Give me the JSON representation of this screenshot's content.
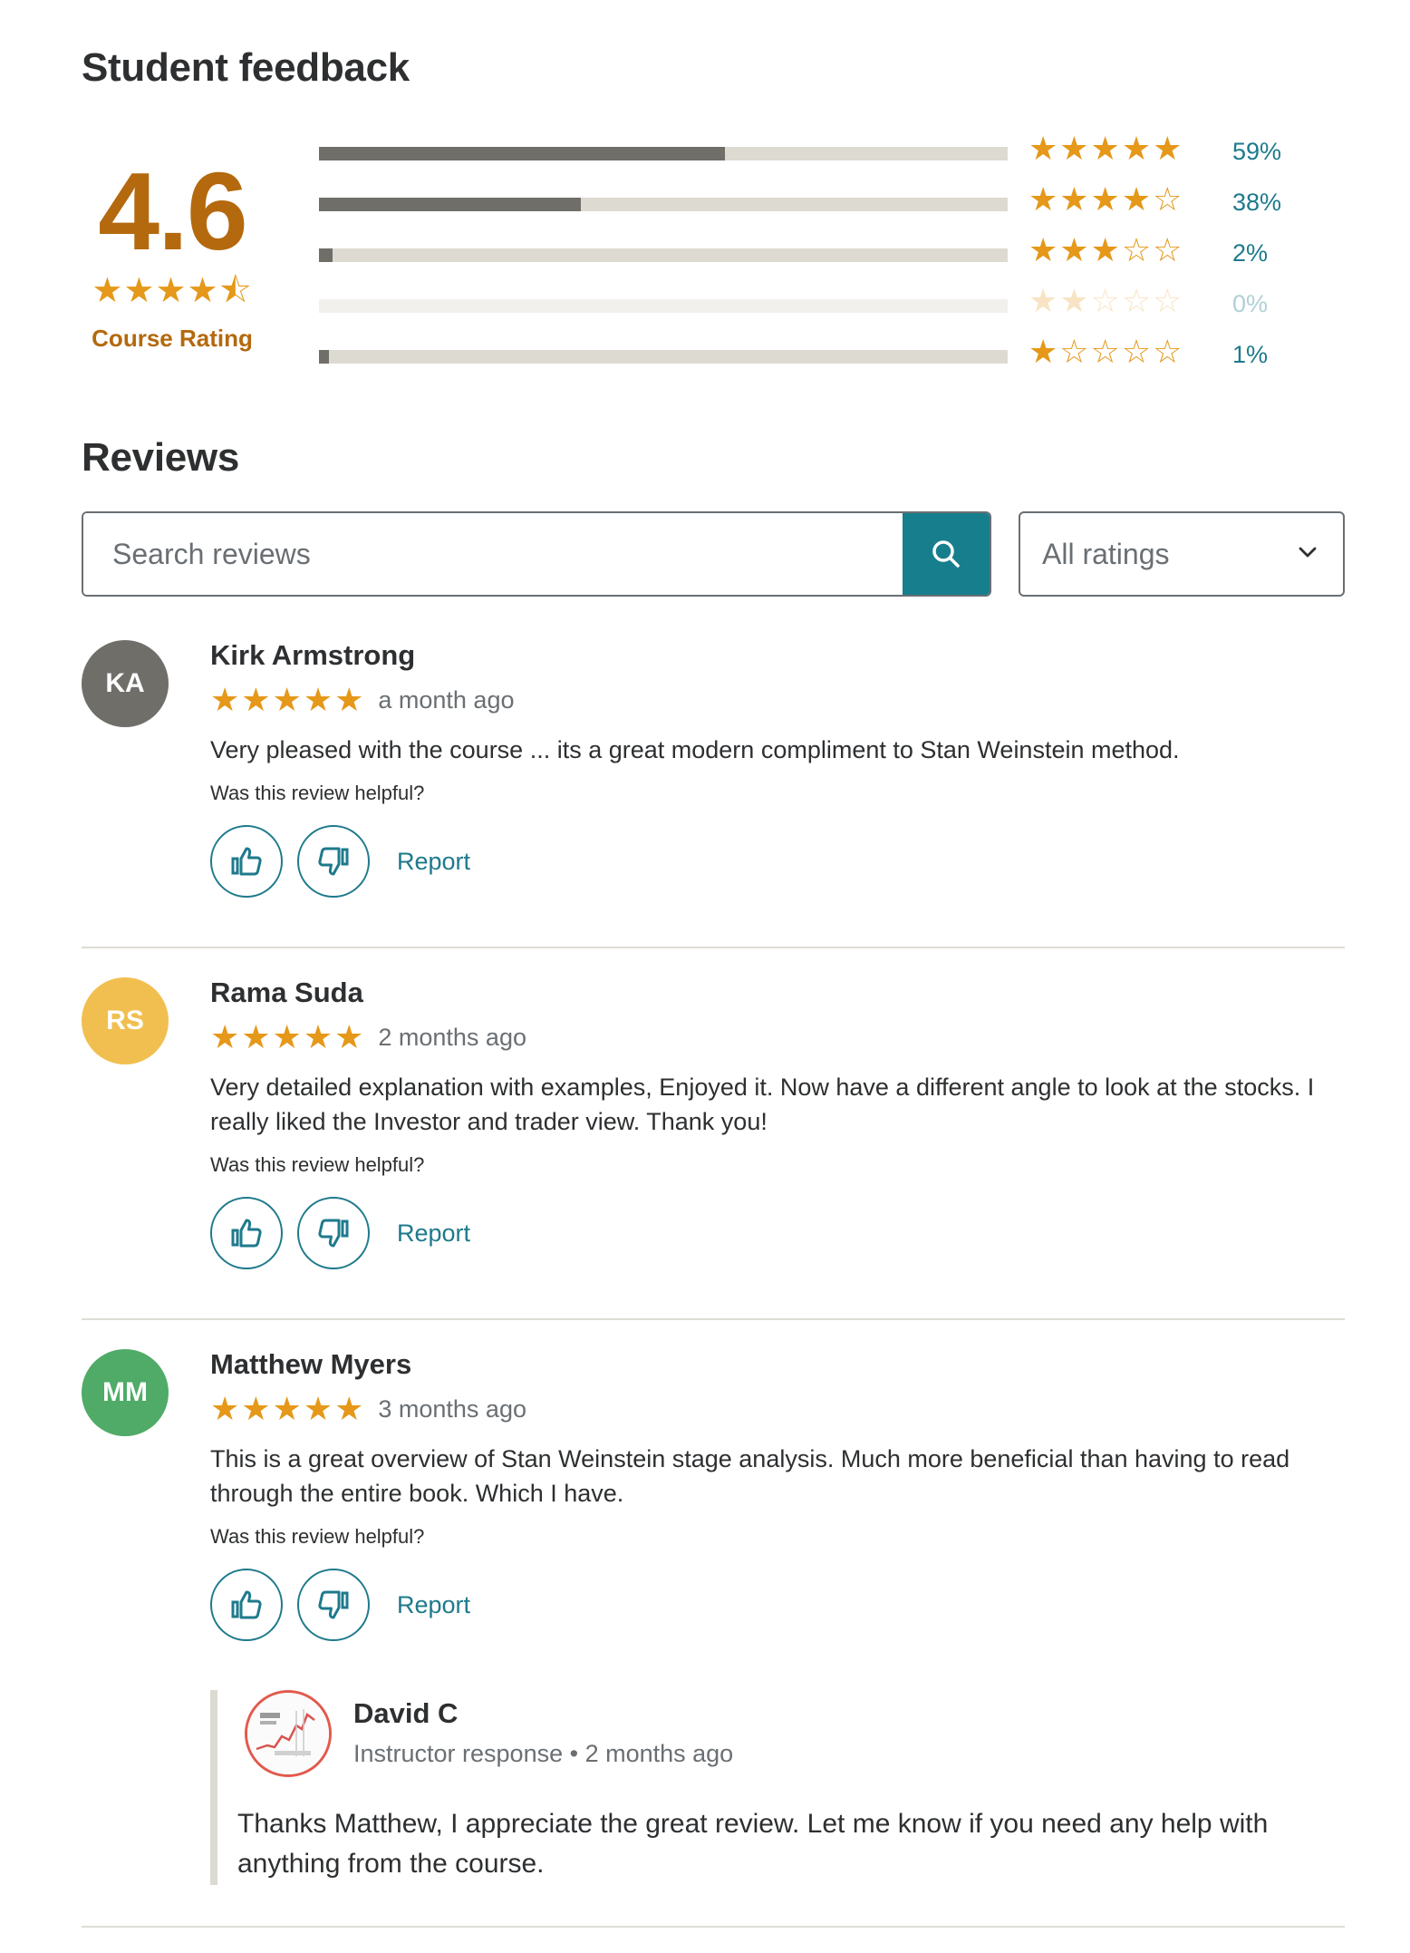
{
  "feedback": {
    "title": "Student feedback",
    "rating": "4.6",
    "rating_stars": "★★★★⯪",
    "rating_label": "Course Rating",
    "distribution": [
      {
        "stars": 5,
        "star_glyphs": "★★★★★",
        "percent_label": "59%",
        "fraction": 0.59
      },
      {
        "stars": 4,
        "star_glyphs": "★★★★☆",
        "percent_label": "38%",
        "fraction": 0.38
      },
      {
        "stars": 3,
        "star_glyphs": "★★★☆☆",
        "percent_label": "2%",
        "fraction": 0.02
      },
      {
        "stars": 2,
        "star_glyphs": "★★☆☆☆",
        "percent_label": "0%",
        "fraction": 0.0
      },
      {
        "stars": 1,
        "star_glyphs": "★☆☆☆☆",
        "percent_label": "1%",
        "fraction": 0.01
      }
    ]
  },
  "reviews_section": {
    "title": "Reviews",
    "search_placeholder": "Search reviews",
    "filter_value": "All ratings"
  },
  "reviews": [
    {
      "initials": "KA",
      "avatar_color": "#6f6e69",
      "name": "Kirk Armstrong",
      "stars": "★★★★★",
      "date": "a month ago",
      "text": "Very pleased with the course ... its a great modern compliment to Stan Weinstein method.",
      "helpful_prompt": "Was this review helpful?",
      "report_label": "Report"
    },
    {
      "initials": "RS",
      "avatar_color": "#f1bf50",
      "name": "Rama Suda",
      "stars": "★★★★★",
      "date": "2 months ago",
      "text": "Very detailed explanation with examples, Enjoyed it. Now have a different angle to look at the stocks. I really liked the Investor and trader view. Thank you!",
      "helpful_prompt": "Was this review helpful?",
      "report_label": "Report"
    },
    {
      "initials": "MM",
      "avatar_color": "#4fab67",
      "name": "Matthew Myers",
      "stars": "★★★★★",
      "date": "3 months ago",
      "text": "This is a great overview of Stan Weinstein stage analysis. Much more beneficial than having to read through the entire book. Which I have.",
      "helpful_prompt": "Was this review helpful?",
      "report_label": "Report"
    }
  ],
  "instructor_response": {
    "name": "David C",
    "meta": "Instructor response • 2 months ago",
    "text": "Thanks Matthew, I appreciate the great review. Let me know if you need any help with anything from the course."
  },
  "colors": {
    "accent": "#1e7a8c",
    "rating": "#b4690e",
    "star": "#e59819"
  }
}
